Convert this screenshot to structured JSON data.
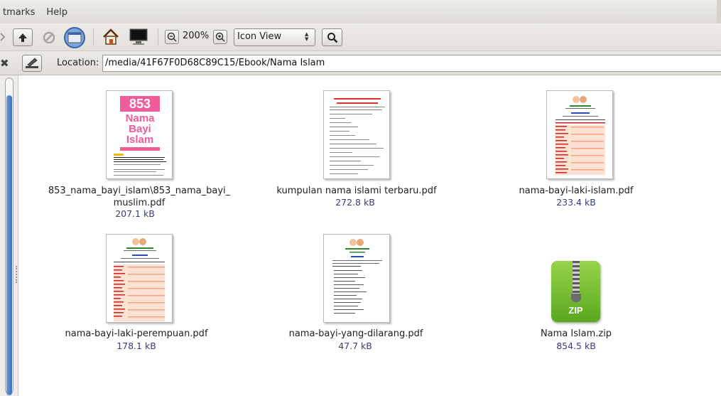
{
  "menubar": {
    "items": [
      "tmarks",
      "Help"
    ]
  },
  "toolbar": {
    "zoom_level": "200%",
    "view_mode": "Icon View"
  },
  "location": {
    "label": "Location:",
    "path": "/media/41F67F0D68C89C15/Ebook/Nama Islam"
  },
  "files": [
    {
      "name": "853_nama_bayi_islam\\853_nama_bayi_\nmuslim.pdf",
      "size": "207.1 kB"
    },
    {
      "name": "kumpulan nama islami terbaru.pdf",
      "size": "272.8 kB"
    },
    {
      "name": "nama-bayi-laki-islam.pdf",
      "size": "233.4 kB"
    },
    {
      "name": "nama-bayi-laki-perempuan.pdf",
      "size": "178.1 kB"
    },
    {
      "name": "nama-bayi-yang-dilarang.pdf",
      "size": "47.7 kB"
    },
    {
      "name": "Nama Islam.zip",
      "size": "854.5 kB"
    }
  ],
  "thumb853": {
    "number": "853",
    "line1": "Nama",
    "line2": "Bayi",
    "line3": "Islam"
  },
  "zip_icon": {
    "label": "ZIP"
  },
  "colors": {
    "accent": "#3b6fc2",
    "size_text": "#3a3c7a",
    "zip_green": "#5aa71f",
    "pink": "#f05c9a"
  }
}
